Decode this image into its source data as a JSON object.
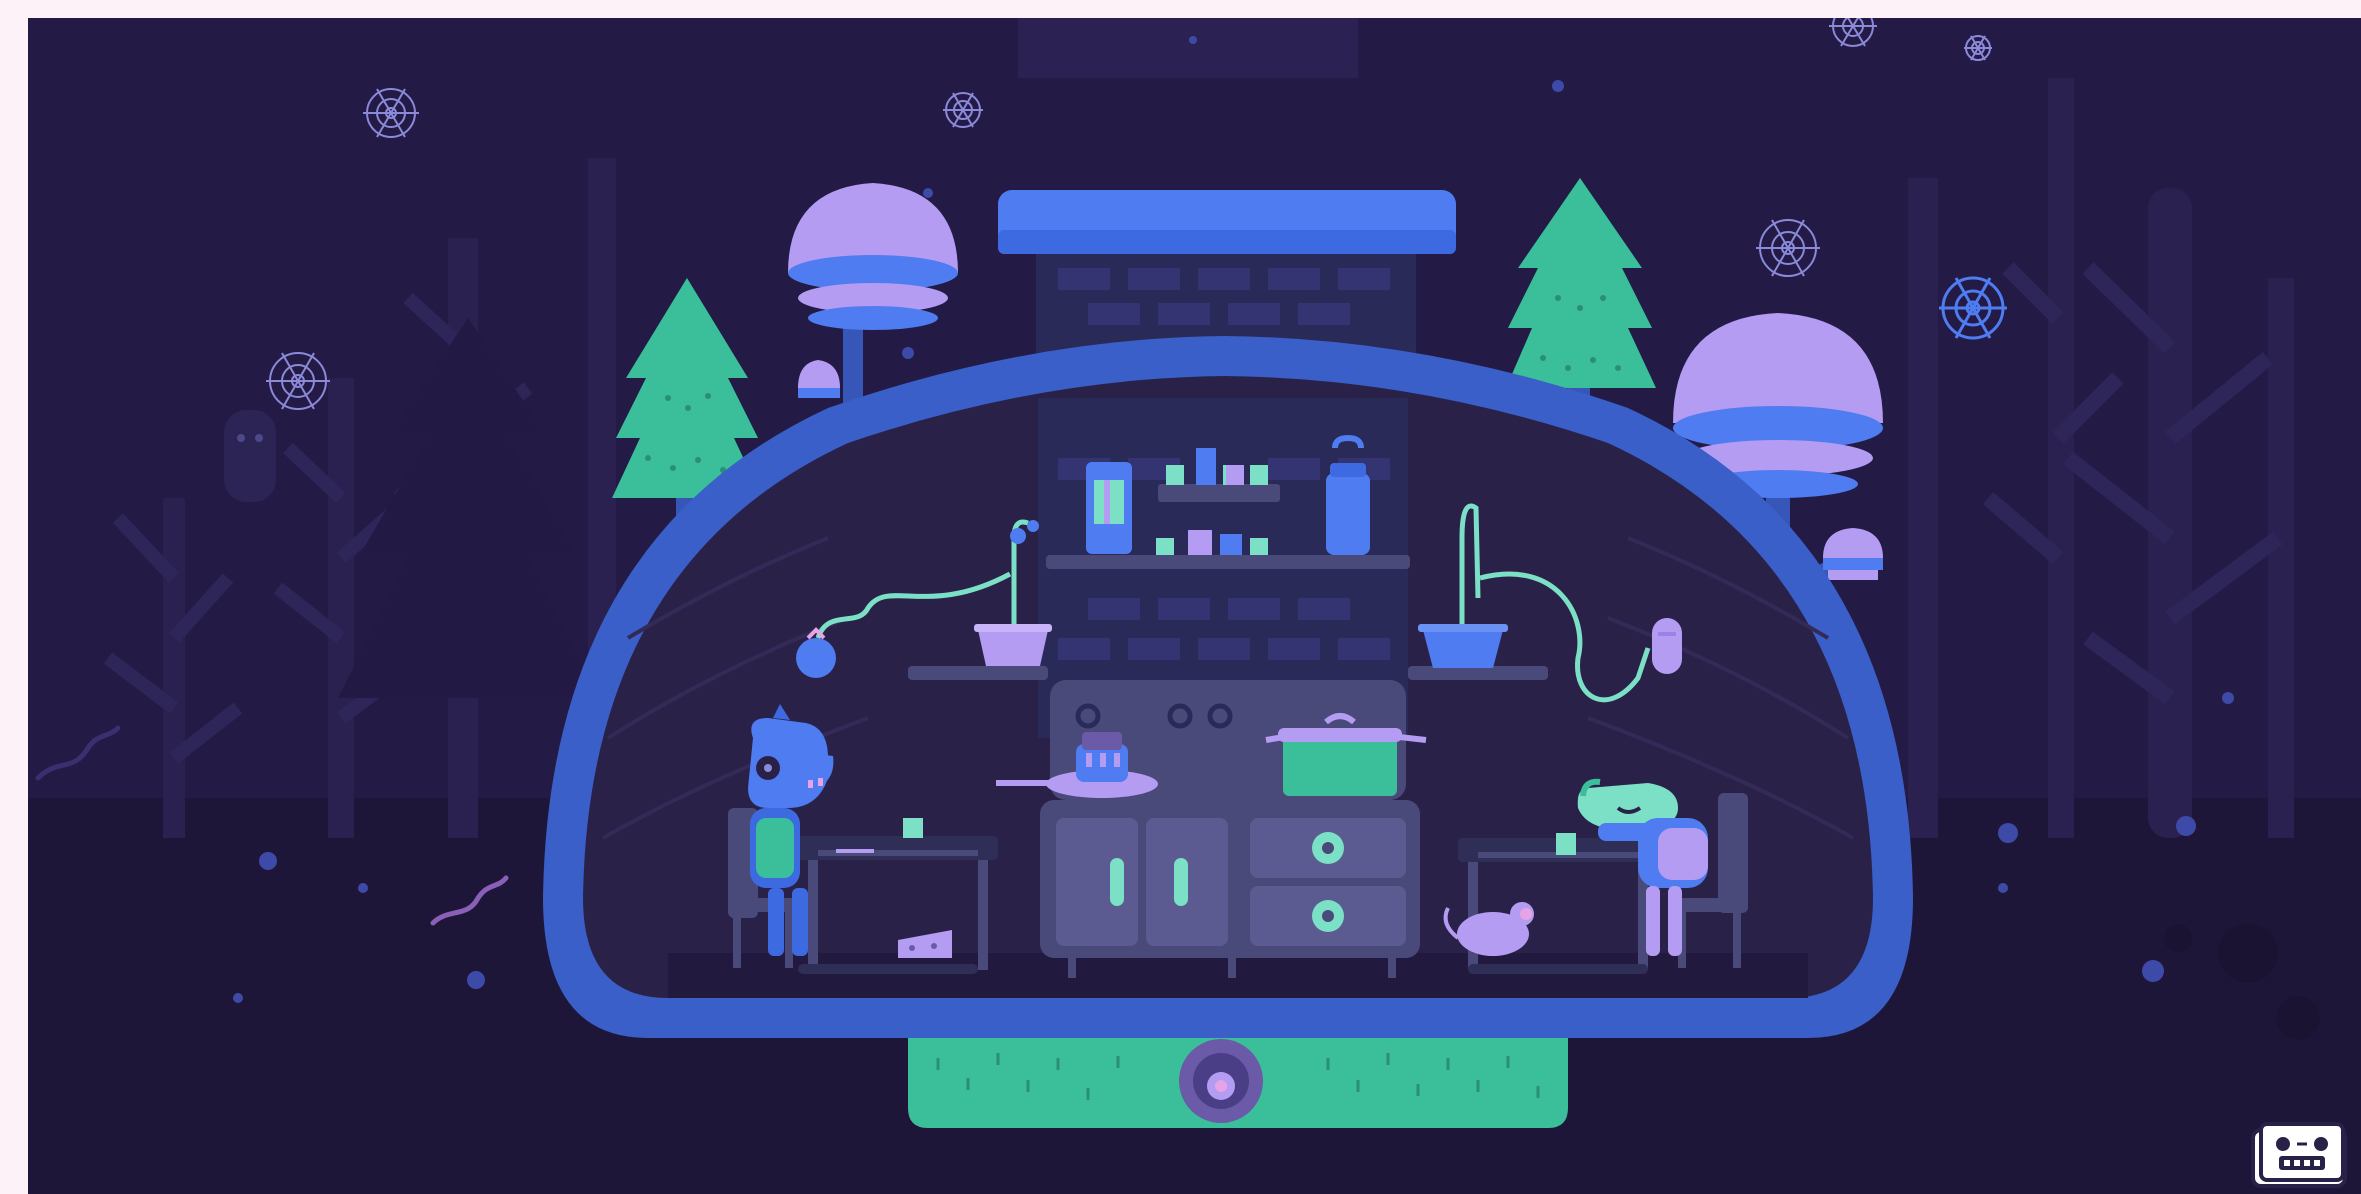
{
  "game": {
    "title": "",
    "scene": "underground-kitchen-burrow"
  },
  "palette": {
    "sky": "#231a46",
    "sky_far": "#2b2152",
    "tree_far": "#2f2656",
    "tree_near": "#1f1740",
    "ground": "#1e1638",
    "dome_rim": "#3a5fc8",
    "dome_inner": "#2a2148",
    "brick": "#2a2a58",
    "mint": "#3bbf9b",
    "mint_light": "#7be0c5",
    "lavender": "#b49cf2",
    "blue": "#4f7cf0",
    "blue_dark": "#3657b8",
    "purple": "#6b5aa8",
    "counter": "#4a4a7a",
    "drawer_knob": "#3bbf9b"
  },
  "icons": {
    "cobweb": "cobweb-icon",
    "robot": "robot-face-icon"
  }
}
